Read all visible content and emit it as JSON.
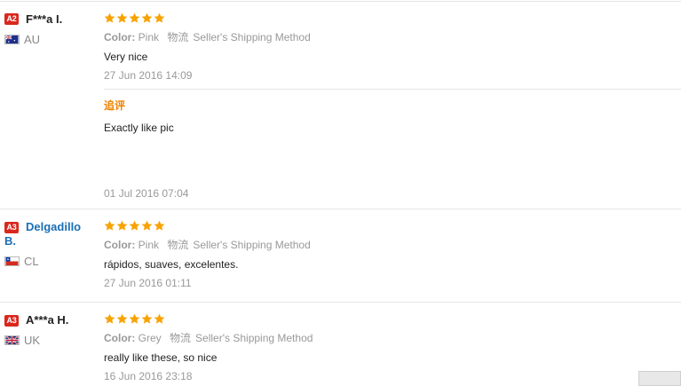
{
  "reviews": [
    {
      "badge": "A2",
      "name": "F***a I.",
      "country": "AU",
      "rating": 5,
      "color_label": "Color:",
      "color_value": "Pink",
      "shipping_cn": "物流",
      "shipping": "Seller's Shipping Method",
      "text": "Very nice",
      "date": "27 Jun 2016 14:09",
      "followup_label": "追评",
      "followup_text": "Exactly like pic",
      "followup_date": "01 Jul 2016 07:04"
    },
    {
      "badge": "A3",
      "name_line1": "Delgadillo",
      "name_line2": "B.",
      "country": "CL",
      "rating": 5,
      "color_label": "Color:",
      "color_value": "Pink",
      "shipping_cn": "物流",
      "shipping": "Seller's Shipping Method",
      "text": "rápidos, suaves, excelentes.",
      "date": "27 Jun 2016 01:11"
    },
    {
      "badge": "A3",
      "name": "A***a H.",
      "country": "UK",
      "rating": 5,
      "color_label": "Color:",
      "color_value": "Grey",
      "shipping_cn": "物流",
      "shipping": "Seller's Shipping Method",
      "text": "really like these, so nice",
      "date": "16 Jun 2016 23:18"
    }
  ],
  "colors": {
    "star": "#f7a300",
    "badge": "#d9271e",
    "followup": "#f08200",
    "link_name": "#1a6fb5"
  }
}
